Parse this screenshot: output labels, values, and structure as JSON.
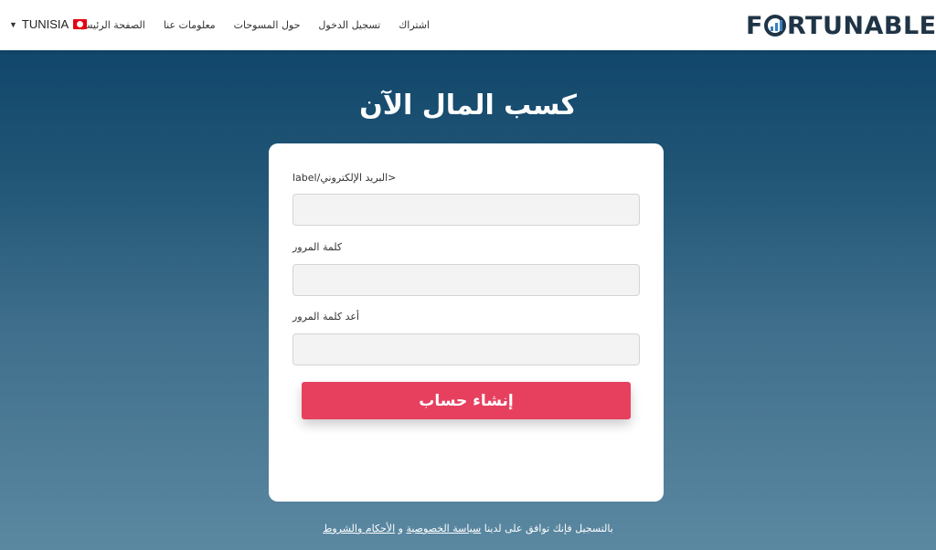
{
  "header": {
    "logo_before": "F",
    "logo_after": "RTUNABLE",
    "nav": [
      "الصفحة الرئيسية",
      "معلومات عنا",
      "حول المسوحات",
      "تسجيل الدخول",
      "اشتراك"
    ],
    "country": "TUNISIA"
  },
  "main": {
    "title": "كسب المال الآن",
    "form": {
      "email_label": "label/البريد الإلكتروني>",
      "password_label": "كلمة المرور",
      "confirm_label": "أعد كلمة المرور",
      "submit_label": "إنشاء حساب"
    }
  },
  "footer": {
    "prefix": "بالتسجيل فإنك توافق على لدينا",
    "privacy_link": "سياسة الخصوصية",
    "conjunction": "و",
    "terms_link": "الأحكام والشروط"
  },
  "colors": {
    "accent": "#e6405e",
    "background_top": "#0b4166",
    "background_bottom": "#5b88a1",
    "logo": "#1f3446"
  }
}
